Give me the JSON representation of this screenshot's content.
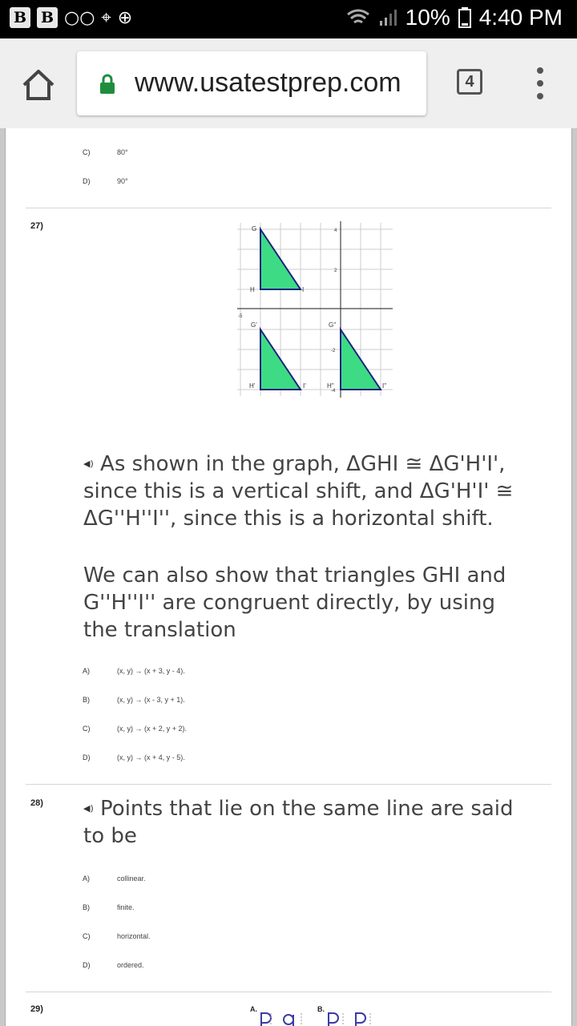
{
  "status_bar": {
    "left_icons": [
      "B",
      "B"
    ],
    "battery": "10%",
    "time": "4:40 PM"
  },
  "browser": {
    "url": "www.usatestprep.com",
    "tab_count": "4"
  },
  "question_26_tail": {
    "options": [
      {
        "letter": "C)",
        "text": "80°"
      },
      {
        "letter": "D)",
        "text": "90°"
      }
    ]
  },
  "question_27": {
    "number": "27)",
    "graph": {
      "labels": {
        "G": "G",
        "H": "H",
        "I": "I",
        "G1": "G'",
        "H1": "H'",
        "I1": "I'",
        "G2": "G''",
        "H2": "H''",
        "I2": "I''"
      },
      "ticks": {
        "y4": "4",
        "y2": "2",
        "yneg2": "-2",
        "yneg4": "-4",
        "xneg5": "-5"
      }
    },
    "text_p1": "As shown in the graph, ΔGHI ≅ ΔG'H'I', since this is a vertical shift, and ΔG'H'I' ≅ ΔG''H''I'', since this is a horizontal shift.",
    "text_p2": "We can also show that triangles GHI and G''H''I'' are congruent directly, by using the translation",
    "options": [
      {
        "letter": "A)",
        "text": "(x, y) → (x + 3, y - 4)."
      },
      {
        "letter": "B)",
        "text": "(x, y) → (x - 3, y + 1)."
      },
      {
        "letter": "C)",
        "text": "(x, y) → (x + 2, y + 2)."
      },
      {
        "letter": "D)",
        "text": "(x, y) → (x + 4, y - 5)."
      }
    ]
  },
  "question_28": {
    "number": "28)",
    "text": "Points that lie on the same line are said to be",
    "options": [
      {
        "letter": "A)",
        "text": "collinear."
      },
      {
        "letter": "B)",
        "text": "finite."
      },
      {
        "letter": "C)",
        "text": "horizontal."
      },
      {
        "letter": "D)",
        "text": "ordered."
      }
    ]
  },
  "question_29": {
    "number": "29)",
    "image_labels": [
      "A.",
      "B."
    ]
  },
  "colors": {
    "triangle_fill": "#3ddc84",
    "triangle_stroke": "#1a237e",
    "grid": "#cccccc",
    "lock_green": "#1e8e3e"
  }
}
